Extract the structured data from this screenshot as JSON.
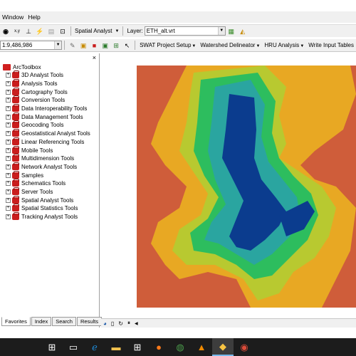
{
  "menubar": {
    "items": [
      "Window",
      "Help"
    ]
  },
  "toolbar1": {
    "spatial_analyst_label": "Spatial Analyst",
    "layer_label": "Layer:",
    "layer_value": "ETH_alt.vrt"
  },
  "toolbar2": {
    "scale_value": "1:9,486,986",
    "swat_menus": [
      "SWAT Project Setup",
      "Watershed Delineator",
      "HRU Analysis",
      "Write Input Tables"
    ]
  },
  "toolbox": {
    "root_label": "ArcToolbox",
    "close_glyph": "×",
    "items": [
      "3D Analyst Tools",
      "Analysis Tools",
      "Cartography Tools",
      "Conversion Tools",
      "Data Interoperability Tools",
      "Data Management Tools",
      "Geocoding Tools",
      "Geostatistical Analyst Tools",
      "Linear Referencing Tools",
      "Mobile Tools",
      "Multidimension Tools",
      "Network Analyst Tools",
      "Samples",
      "Schematics Tools",
      "Server Tools",
      "Spatial Analyst Tools",
      "Spatial Statistics Tools",
      "Tracking Analyst Tools"
    ],
    "tabs": [
      "Favorites",
      "Index",
      "Search",
      "Results"
    ]
  },
  "map": {
    "layer_colors": [
      "#cf5d3a",
      "#e8a823",
      "#b8c930",
      "#2dbd5e",
      "#2aa5a0",
      "#0b3c8e"
    ]
  },
  "taskbar": {
    "icons": [
      "windows-start-icon",
      "task-view-icon",
      "edge-icon",
      "file-explorer-icon",
      "store-icon",
      "firefox-icon",
      "globe-app-icon",
      "vlc-icon",
      "arcmap-icon",
      "chrome-icon"
    ]
  }
}
